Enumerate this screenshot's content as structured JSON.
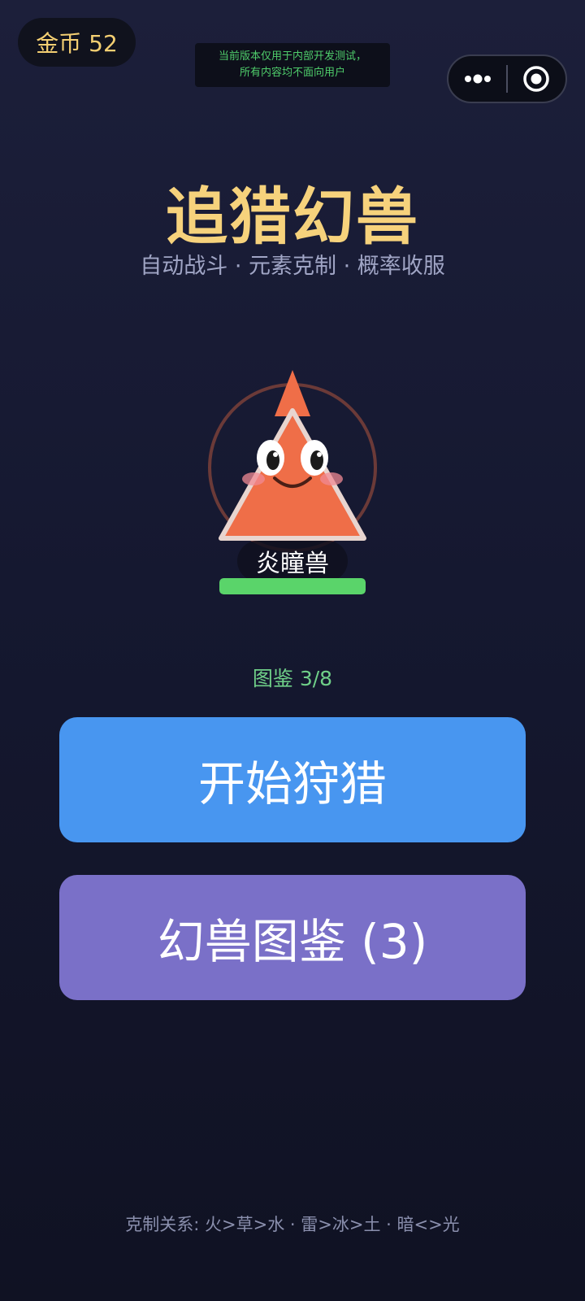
{
  "header": {
    "coins_label": "金币 52",
    "dev_notice_line1": "当前版本仅用于内部开发测试，",
    "dev_notice_line2": "所有内容均不面向用户",
    "menu_icon": "more-dots-icon",
    "close_icon": "target-close-icon"
  },
  "hero": {
    "title": "追猎幻兽",
    "subtitle": "自动战斗 · 元素克制 · 概率收服"
  },
  "monster": {
    "name": "炎瞳兽",
    "hp_fraction": 1.0,
    "body_color": "#ef6e48",
    "ring_color": "#6b3a38",
    "hp_color": "#5ad46a"
  },
  "progress": {
    "codex_label": "图鉴 3/8"
  },
  "actions": {
    "hunt_label": "开始狩猎",
    "codex_label": "幻兽图鉴 (3)",
    "hunt_color": "#4896f0",
    "codex_color": "#7a70c8"
  },
  "footer": {
    "rules_text": "克制关系: 火>草>水 · 雷>冰>土 · 暗<>光"
  }
}
